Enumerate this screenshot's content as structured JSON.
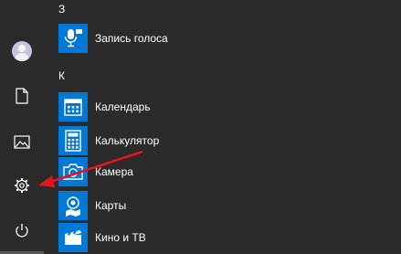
{
  "sidebar": {
    "items": [
      {
        "name": "avatar",
        "icon": "user-avatar-icon"
      },
      {
        "name": "documents",
        "icon": "document-icon"
      },
      {
        "name": "pictures",
        "icon": "image-icon"
      },
      {
        "name": "settings",
        "icon": "gear-icon"
      },
      {
        "name": "power",
        "icon": "power-icon"
      }
    ]
  },
  "app_list": {
    "groups": [
      {
        "letter": "З",
        "apps": [
          {
            "label": "Запись голоса",
            "icon": "microphone-icon"
          }
        ]
      },
      {
        "letter": "К",
        "apps": [
          {
            "label": "Календарь",
            "icon": "calendar-icon"
          },
          {
            "label": "Калькулятор",
            "icon": "calculator-icon"
          },
          {
            "label": "Камера",
            "icon": "camera-icon"
          },
          {
            "label": "Карты",
            "icon": "map-icon"
          },
          {
            "label": "Кино и ТВ",
            "icon": "film-icon"
          }
        ]
      }
    ]
  },
  "colors": {
    "background": "#2b2b2b",
    "tile": "#0078d7",
    "annotation_arrow": "#e8141b"
  }
}
